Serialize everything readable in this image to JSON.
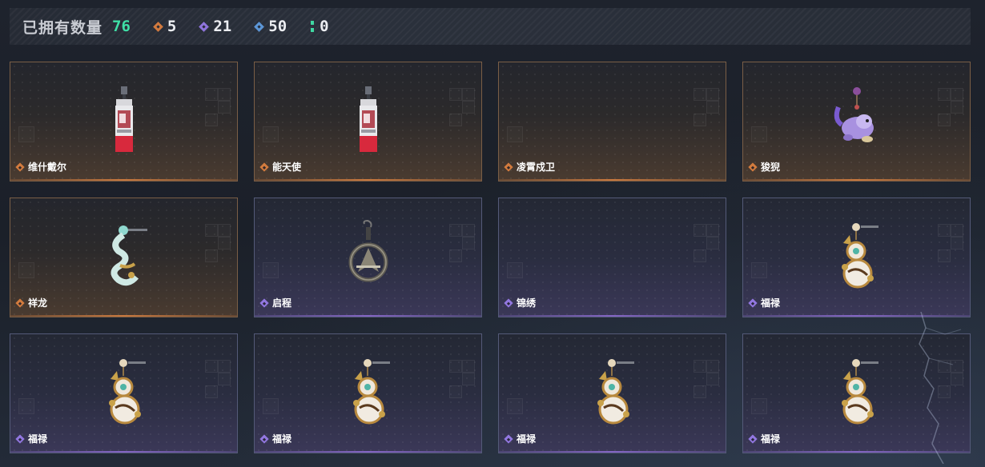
{
  "header": {
    "owned_label": "已拥有数量",
    "owned_count": "76",
    "stats": [
      {
        "icon": "orange-rarity-icon",
        "color": "#d17a3f",
        "value": "5"
      },
      {
        "icon": "purple-rarity-icon",
        "color": "#8f74dc",
        "value": "21"
      },
      {
        "icon": "blue-rarity-icon",
        "color": "#5c96d6",
        "value": "50"
      },
      {
        "icon": "green-rarity-icon",
        "color": "#3fd9a3",
        "value": "0"
      }
    ]
  },
  "colors": {
    "orange": "#d27b3e",
    "purple": "#9277e0",
    "owned_count": "#3fdfa6"
  },
  "items": [
    {
      "name": "维什戴尔",
      "rarity": "orange",
      "art": "tag-charm"
    },
    {
      "name": "能天使",
      "rarity": "orange",
      "art": "tag-charm"
    },
    {
      "name": "凌霄戍卫",
      "rarity": "orange",
      "art": "none"
    },
    {
      "name": "狻猊",
      "rarity": "orange",
      "art": "beast-charm"
    },
    {
      "name": "祥龙",
      "rarity": "orange",
      "art": "dragon-charm"
    },
    {
      "name": "启程",
      "rarity": "purple",
      "art": "ring-charm"
    },
    {
      "name": "锦绣",
      "rarity": "purple",
      "art": "none"
    },
    {
      "name": "福禄",
      "rarity": "purple",
      "art": "gourd-charm"
    },
    {
      "name": "福禄",
      "rarity": "purple",
      "art": "gourd-charm"
    },
    {
      "name": "福禄",
      "rarity": "purple",
      "art": "gourd-charm"
    },
    {
      "name": "福禄",
      "rarity": "purple",
      "art": "gourd-charm"
    },
    {
      "name": "福禄",
      "rarity": "purple",
      "art": "gourd-charm"
    }
  ]
}
